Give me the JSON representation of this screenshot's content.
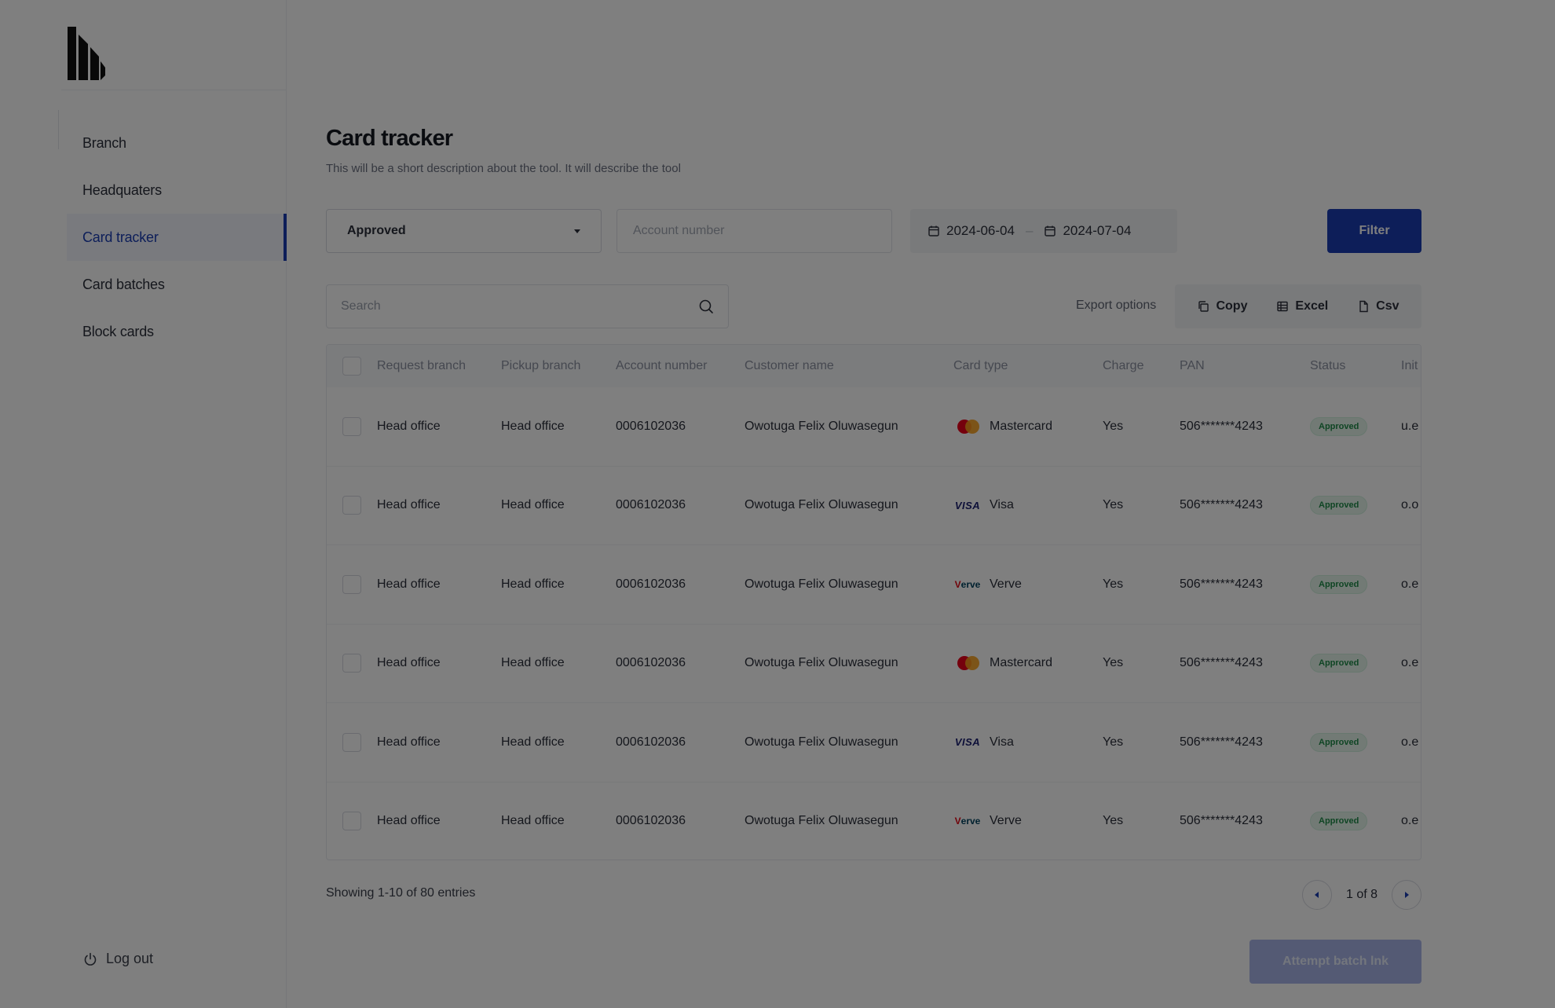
{
  "sidebar": {
    "items": [
      {
        "label": "Branch"
      },
      {
        "label": "Headquaters"
      },
      {
        "label": "Card tracker"
      },
      {
        "label": "Card batches"
      },
      {
        "label": "Block cards"
      }
    ],
    "active_index": 2,
    "logout_label": "Log out"
  },
  "page": {
    "title": "Card tracker",
    "description": "This will be a short description about the tool. It will describe the tool"
  },
  "filters": {
    "status_value": "Approved",
    "account_placeholder": "Account number",
    "date_from": "2024-06-04",
    "date_separator": "–",
    "date_to": "2024-07-04",
    "filter_label": "Filter"
  },
  "toolbar": {
    "search_placeholder": "Search",
    "export_label": "Export options",
    "copy_label": "Copy",
    "excel_label": "Excel",
    "csv_label": "Csv"
  },
  "table": {
    "columns": [
      "Request branch",
      "Pickup branch",
      "Account number",
      "Customer name",
      "Card type",
      "Charge",
      "PAN",
      "Status",
      "Init"
    ],
    "rows": [
      {
        "request_branch": "Head office",
        "pickup_branch": "Head office",
        "account": "0006102036",
        "name": "Owotuga Felix Oluwasegun",
        "card_brand_icon": "mastercard-icon",
        "card_type": "Mastercard",
        "charge": "Yes",
        "pan": "506*******4243",
        "status": "Approved",
        "init": "u.e"
      },
      {
        "request_branch": "Head office",
        "pickup_branch": "Head office",
        "account": "0006102036",
        "name": "Owotuga Felix Oluwasegun",
        "card_brand_icon": "visa-icon",
        "card_type": "Visa",
        "charge": "Yes",
        "pan": "506*******4243",
        "status": "Approved",
        "init": "o.o"
      },
      {
        "request_branch": "Head office",
        "pickup_branch": "Head office",
        "account": "0006102036",
        "name": "Owotuga Felix Oluwasegun",
        "card_brand_icon": "verve-icon",
        "card_type": "Verve",
        "charge": "Yes",
        "pan": "506*******4243",
        "status": "Approved",
        "init": "o.e"
      },
      {
        "request_branch": "Head office",
        "pickup_branch": "Head office",
        "account": "0006102036",
        "name": "Owotuga Felix Oluwasegun",
        "card_brand_icon": "mastercard-icon",
        "card_type": "Mastercard",
        "charge": "Yes",
        "pan": "506*******4243",
        "status": "Approved",
        "init": "o.e"
      },
      {
        "request_branch": "Head office",
        "pickup_branch": "Head office",
        "account": "0006102036",
        "name": "Owotuga Felix Oluwasegun",
        "card_brand_icon": "visa-icon",
        "card_type": "Visa",
        "charge": "Yes",
        "pan": "506*******4243",
        "status": "Approved",
        "init": "o.e"
      },
      {
        "request_branch": "Head office",
        "pickup_branch": "Head office",
        "account": "0006102036",
        "name": "Owotuga Felix Oluwasegun",
        "card_brand_icon": "verve-icon",
        "card_type": "Verve",
        "charge": "Yes",
        "pan": "506*******4243",
        "status": "Approved",
        "init": "o.e"
      }
    ]
  },
  "footer": {
    "entries_text": "Showing 1-10 of 80 entries",
    "page_text": "1 of 8"
  },
  "batch_button_label": "Attempt batch lnk",
  "colors": {
    "primary": "#1a3db3",
    "status_green": "#1f8a48",
    "overlay": "rgba(0,0,0,0.5)"
  }
}
